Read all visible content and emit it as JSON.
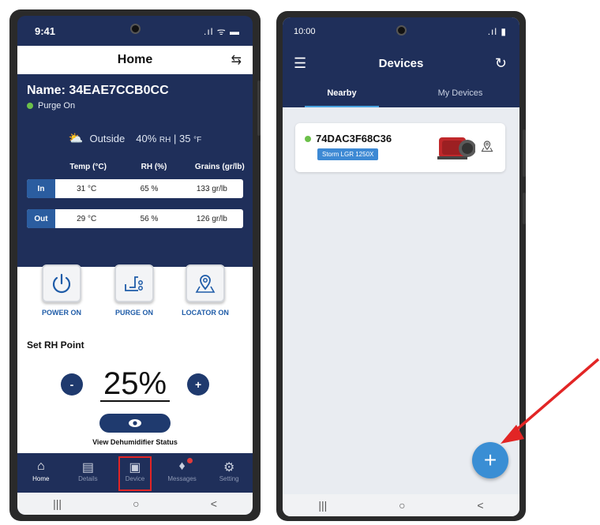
{
  "home_screen": {
    "status_time": "9:41",
    "status_icons": ".ıl ᯤ ▬",
    "header_title": "Home",
    "device_name": "Name: 34EAE7CCB0CC",
    "purge_status": "Purge On",
    "outside": {
      "label": "Outside",
      "rh_value": "40%",
      "rh_unit": "RH",
      "separator": "|",
      "temp_value": "35",
      "temp_unit": "°F"
    },
    "table": {
      "headers": [
        "Temp (°C)",
        "RH (%)",
        "Grains (gr/lb)"
      ],
      "rows": [
        {
          "label": "In",
          "temp": "31 °C",
          "rh": "65 %",
          "grains": "133 gr/lb"
        },
        {
          "label": "Out",
          "temp": "29 °C",
          "rh": "56 %",
          "grains": "126 gr/lb"
        }
      ]
    },
    "controls": {
      "power_label": "POWER ON",
      "purge_label": "PURGE ON",
      "locator_label": "LOCATOR ON"
    },
    "set_rh_title": "Set RH Point",
    "rh_value": "25%",
    "minus_label": "-",
    "plus_label": "+",
    "view_status_label": "View Dehumidifier Status",
    "tabs": [
      {
        "label": "Home",
        "icon": "home-icon"
      },
      {
        "label": "Details",
        "icon": "details-icon"
      },
      {
        "label": "Device",
        "icon": "device-icon"
      },
      {
        "label": "Messages",
        "icon": "bell-icon"
      },
      {
        "label": "Setting",
        "icon": "gear-icon"
      }
    ],
    "navbar": {
      "recents": "|||",
      "home": "○",
      "back": "<"
    }
  },
  "devices_screen": {
    "status_time": "10:00",
    "status_icons": ".ıl ▮",
    "title": "Devices",
    "tab_nearby": "Nearby",
    "tab_my_devices": "My Devices",
    "device": {
      "name": "74DAC3F68C36",
      "model": "Storm LGR 1250X",
      "status_color": "#6cc04a"
    },
    "fab_label": "+",
    "navbar": {
      "recents": "|||",
      "home": "○",
      "back": "<"
    }
  },
  "colors": {
    "navy": "#1f2f5a",
    "accent_blue": "#3a8ed4",
    "highlight_red": "#e22525"
  }
}
